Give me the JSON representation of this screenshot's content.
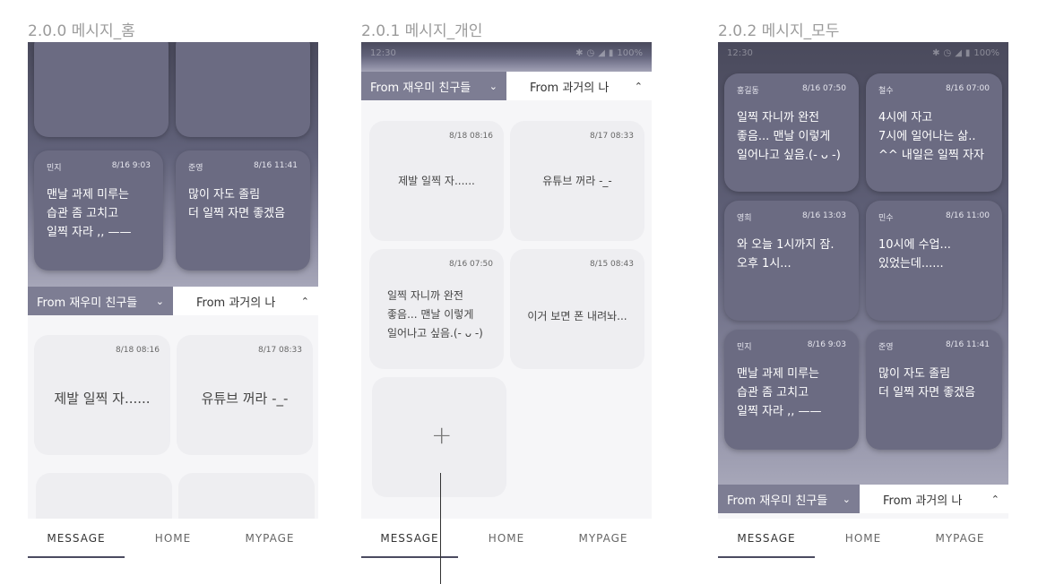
{
  "titles": {
    "home": "2.0.0 메시지_홈",
    "personal": "2.0.1 메시지_개인",
    "all": "2.0.2 메시지_모두"
  },
  "status": {
    "time": "12:30",
    "battery": "100%"
  },
  "tabs": {
    "friends": "From 재우미 친구들",
    "past": "From 과거의 나"
  },
  "nav": {
    "message": "MESSAGE",
    "home": "HOME",
    "mypage": "MYPAGE"
  },
  "home_dark": [
    {
      "name": "민지",
      "date": "8/16 9:03",
      "text": "맨날 과제 미루는\n습관 좀 고치고\n일찍 자라 ,, ——"
    },
    {
      "name": "준영",
      "date": "8/16 11:41",
      "text": "많이 자도 졸림\n더 일찍 자면 좋겠음"
    }
  ],
  "home_light": [
    {
      "date": "8/18 08:16",
      "text": "제발 일찍 자......"
    },
    {
      "date": "8/17 08:33",
      "text": "유튜브 꺼라 -_-"
    }
  ],
  "personal_light": [
    {
      "date": "8/18 08:16",
      "text": "제발 일찍 자......"
    },
    {
      "date": "8/17 08:33",
      "text": "유튜브 꺼라 -_-"
    },
    {
      "date": "8/16 07:50",
      "text": "일찍 자니까 완전\n좋음... 맨날 이렇게\n일어나고 싶음.(- ᴗ -)"
    },
    {
      "date": "8/15 08:43",
      "text": "이거 보면 폰 내려놔..."
    }
  ],
  "add_symbol": "+",
  "all_dark": [
    {
      "name": "홍길동",
      "date": "8/16 07:50",
      "text": "일찍 자니까 완전\n좋음... 맨날 이렇게\n일어나고 싶음.(- ᴗ -)"
    },
    {
      "name": "철수",
      "date": "8/16 07:00",
      "text": "4시에 자고\n7시에 일어나는 삶..\n^^ 내일은 일찍 자자"
    },
    {
      "name": "영희",
      "date": "8/16 13:03",
      "text": "와 오늘 1시까지 잠.\n오후 1시..."
    },
    {
      "name": "민수",
      "date": "8/16 11:00",
      "text": "10시에 수업...\n있었는데......"
    },
    {
      "name": "민지",
      "date": "8/16 9:03",
      "text": "맨날 과제 미루는\n습관 좀 고치고\n일찍 자라 ,, ——"
    },
    {
      "name": "준영",
      "date": "8/16 11:41",
      "text": "많이 자도 졸림\n더 일찍 자면 좋겠음"
    }
  ]
}
